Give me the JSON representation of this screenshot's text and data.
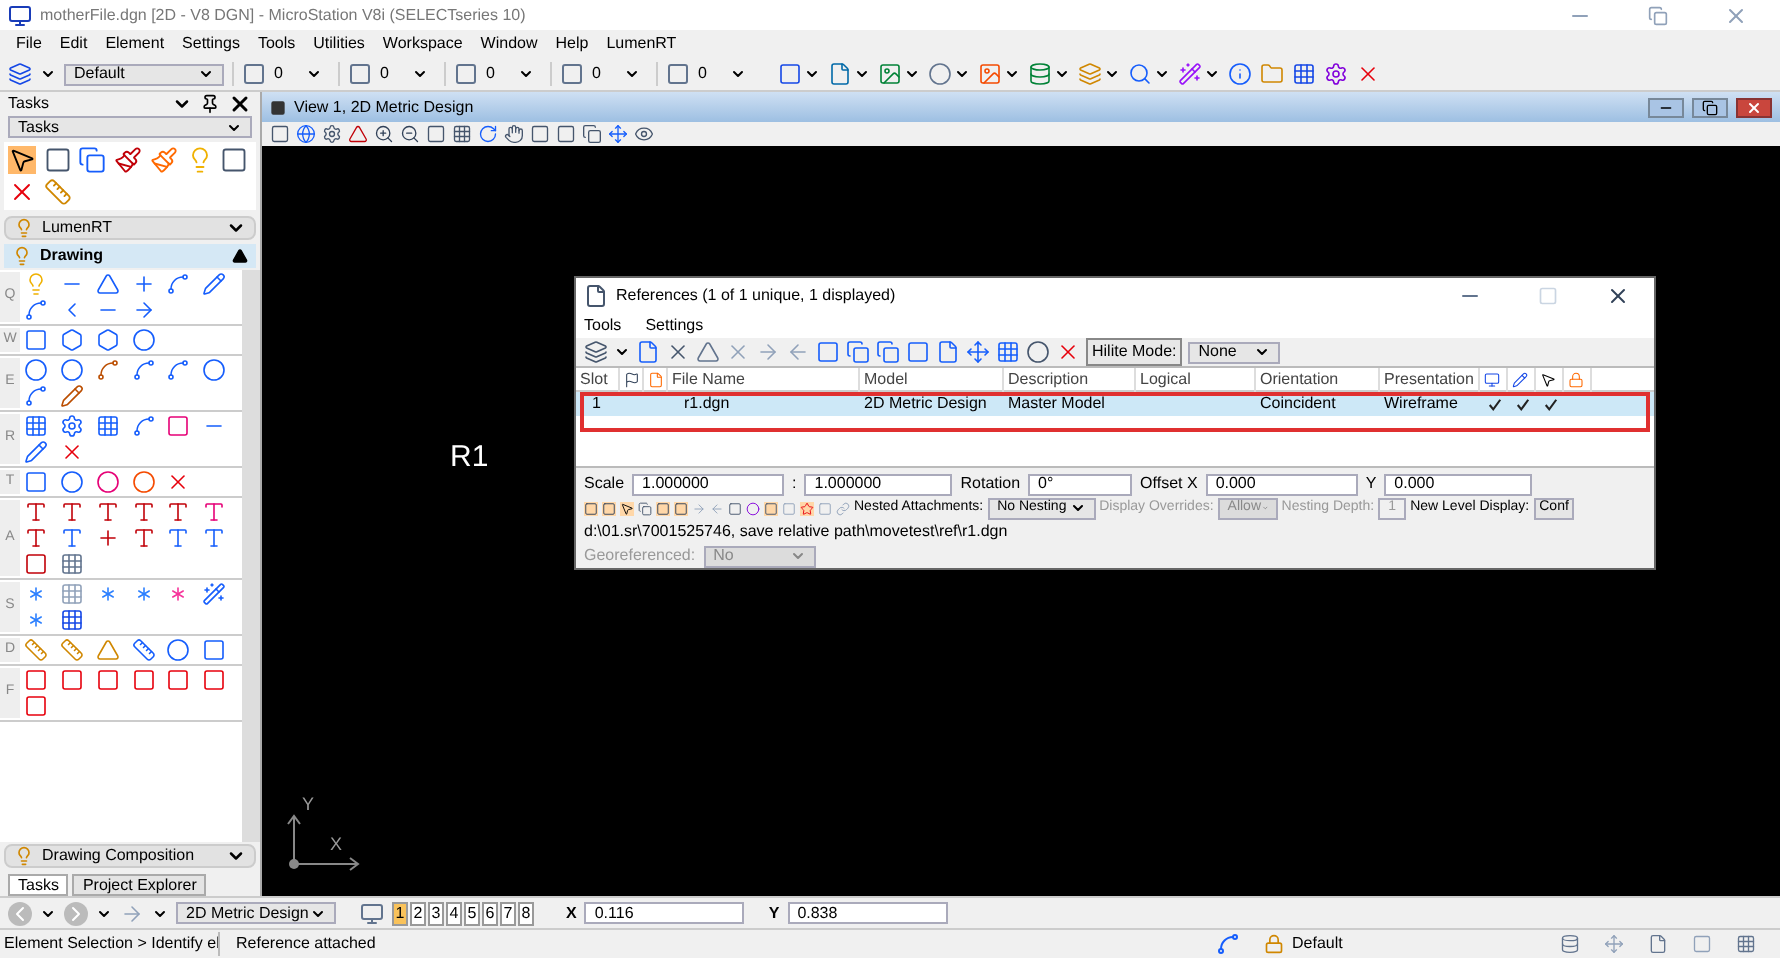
{
  "window": {
    "title": "motherFile.dgn [2D - V8 DGN] - MicroStation V8i (SELECTseries 10)"
  },
  "menu": [
    "File",
    "Edit",
    "Element",
    "Settings",
    "Tools",
    "Utilities",
    "Workspace",
    "Window",
    "Help",
    "LumenRT"
  ],
  "toolbar": {
    "active_level": "Default",
    "counters": [
      "0",
      "0",
      "0",
      "0",
      "0"
    ]
  },
  "tasks_panel": {
    "title": "Tasks",
    "dropdown": "Tasks",
    "sections": [
      {
        "title": "LumenRT",
        "expanded": false
      },
      {
        "title": "Drawing",
        "expanded": true
      },
      {
        "title": "Drawing Composition",
        "expanded": false
      }
    ],
    "groups": [
      {
        "key": "Q"
      },
      {
        "key": "W"
      },
      {
        "key": "E"
      },
      {
        "key": "R"
      },
      {
        "key": "T"
      },
      {
        "key": "A"
      },
      {
        "key": "S"
      },
      {
        "key": "D"
      },
      {
        "key": "F"
      }
    ],
    "tabs": [
      {
        "label": "Tasks",
        "selected": true
      },
      {
        "label": "Project Explorer",
        "selected": false
      }
    ]
  },
  "view": {
    "title": "View 1, 2D Metric Design",
    "canvas_text": "R1",
    "axes": {
      "x": "X",
      "y": "Y"
    }
  },
  "references_dialog": {
    "title": "References (1 of 1 unique, 1 displayed)",
    "menu": [
      "Tools",
      "Settings"
    ],
    "hilite_mode": {
      "label": "Hilite Mode:",
      "value": "None"
    },
    "columns": [
      {
        "kind": "text",
        "label": "Slot"
      },
      {
        "kind": "icon"
      },
      {
        "kind": "icon"
      },
      {
        "kind": "text",
        "label": "File Name"
      },
      {
        "kind": "text",
        "label": "Model"
      },
      {
        "kind": "text",
        "label": "Description"
      },
      {
        "kind": "text",
        "label": "Logical"
      },
      {
        "kind": "text",
        "label": "Orientation"
      },
      {
        "kind": "text",
        "label": "Presentation"
      },
      {
        "kind": "icon"
      },
      {
        "kind": "icon"
      },
      {
        "kind": "icon"
      },
      {
        "kind": "icon"
      }
    ],
    "rows": [
      {
        "selected": true,
        "slot": "1",
        "file_name": "r1.dgn",
        "model": "2D Metric Design",
        "description": "Master Model",
        "orientation": "Coincident",
        "presentation": "Wireframe",
        "checks": [
          true,
          true,
          true,
          false
        ]
      }
    ],
    "scale": {
      "label": "Scale",
      "value1": "1.000000",
      "separator": ":",
      "value2": "1.000000"
    },
    "rotation": {
      "label": "Rotation",
      "value": "0°"
    },
    "offset_x": {
      "label": "Offset X",
      "value": "0.000"
    },
    "offset_y": {
      "label": "Y",
      "value": "0.000"
    },
    "nested_attachments": {
      "label": "Nested Attachments:",
      "value": "No Nesting",
      "disabled": false
    },
    "display_overrides": {
      "label": "Display Overrides:",
      "value": "Allow",
      "disabled": true
    },
    "nesting_depth": {
      "label": "Nesting Depth:",
      "value": "1",
      "disabled": true
    },
    "new_level_display": {
      "label": "New Level Display:",
      "value": "Conf"
    },
    "path": "d:\\01.sr\\7001525746, save relative path\\movetest\\ref\\r1.dgn",
    "georeferenced": {
      "label": "Georeferenced:",
      "value": "No",
      "disabled": true
    }
  },
  "view_bar": {
    "model": "2D Metric Design",
    "views": [
      {
        "label": "1",
        "selected": true
      },
      {
        "label": "2",
        "selected": false
      },
      {
        "label": "3",
        "selected": false
      },
      {
        "label": "4",
        "selected": false
      },
      {
        "label": "5",
        "selected": false
      },
      {
        "label": "6",
        "selected": false
      },
      {
        "label": "7",
        "selected": false
      },
      {
        "label": "8",
        "selected": false
      }
    ],
    "x": {
      "label": "X",
      "value": "0.116"
    },
    "y": {
      "label": "Y",
      "value": "0.838"
    }
  },
  "status_bar": {
    "prompt": "Element Selection > Identify el",
    "message": "Reference attached",
    "level": "Default"
  }
}
